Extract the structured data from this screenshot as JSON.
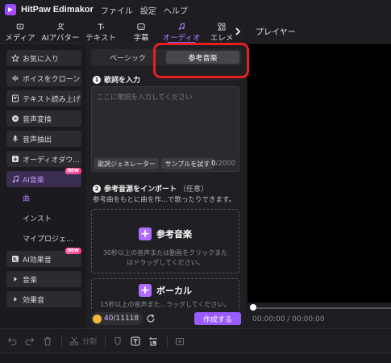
{
  "app": {
    "title": "HitPaw Edimakor"
  },
  "menu": [
    "ファイル",
    "設定",
    "ヘルプ"
  ],
  "toolbar": {
    "tabs": [
      {
        "label": "メディア",
        "icon": "media-icon"
      },
      {
        "label": "AIアバター",
        "icon": "avatar-icon"
      },
      {
        "label": "テキスト",
        "icon": "text-icon"
      },
      {
        "label": "字幕",
        "icon": "subtitle-icon"
      },
      {
        "label": "オーディオ",
        "icon": "music-note-icon",
        "active": true
      },
      {
        "label": "エレメ",
        "icon": "elements-icon"
      }
    ]
  },
  "player": {
    "title": "プレイヤー",
    "time": "00:00:00 / 00:00:00"
  },
  "sidebar": {
    "items": [
      {
        "label": "お気に入り",
        "icon": "star-icon"
      },
      {
        "label": "ボイスをクローン",
        "icon": "clone-icon"
      },
      {
        "label": "テキスト読み上げ",
        "icon": "tts-icon"
      },
      {
        "label": "音声変換",
        "icon": "voice-convert-icon"
      },
      {
        "label": "音声抽出",
        "icon": "mic-icon"
      },
      {
        "label": "オーディオダウ...",
        "icon": "download-icon"
      },
      {
        "label": "AI音楽",
        "icon": "ai-music-icon",
        "active": true,
        "badge": "NEW"
      },
      {
        "label": "AI効果音",
        "icon": "ai-sfx-icon",
        "badge": "NEW"
      },
      {
        "label": "音楽",
        "icon": "chevron-right-icon"
      },
      {
        "label": "効果音",
        "icon": "chevron-right-icon"
      }
    ],
    "subitems": [
      {
        "label": "曲",
        "active": true
      },
      {
        "label": "インスト"
      },
      {
        "label": "マイプロジェ..."
      }
    ]
  },
  "main": {
    "tabs": [
      {
        "label": "ベーシック"
      },
      {
        "label": "参考音楽",
        "active": true
      }
    ],
    "step1": {
      "num": "1",
      "title": "歌詞を入力"
    },
    "lyrics": {
      "placeholder": "ここに歌詞を入力してください",
      "generator_label": "歌詞ジェネレーター",
      "sample_label": "サンプルを試す",
      "count": "0",
      "max": "/2000"
    },
    "step2": {
      "num": "2",
      "title": "参考音源をインポート",
      "optional": "（任意）"
    },
    "import_desc": "参考曲をもとに曲を作...で歌ったりできます。",
    "ref_drop": {
      "title": "参考音楽",
      "desc": "30秒以上の音声または動画をクリックまたはドラッグしてください。"
    },
    "vocal_drop": {
      "title": "ボーカル",
      "desc": "15秒以上の音声また...ラッグしてください。"
    },
    "credits": {
      "used": "40",
      "total": "/11118"
    },
    "create_label": "作成する"
  },
  "bottom_toolbar": {
    "split_label": "分割"
  },
  "colors": {
    "accent": "#9b5cff",
    "highlight": "#e62020",
    "badge": "#ff3d8c"
  }
}
